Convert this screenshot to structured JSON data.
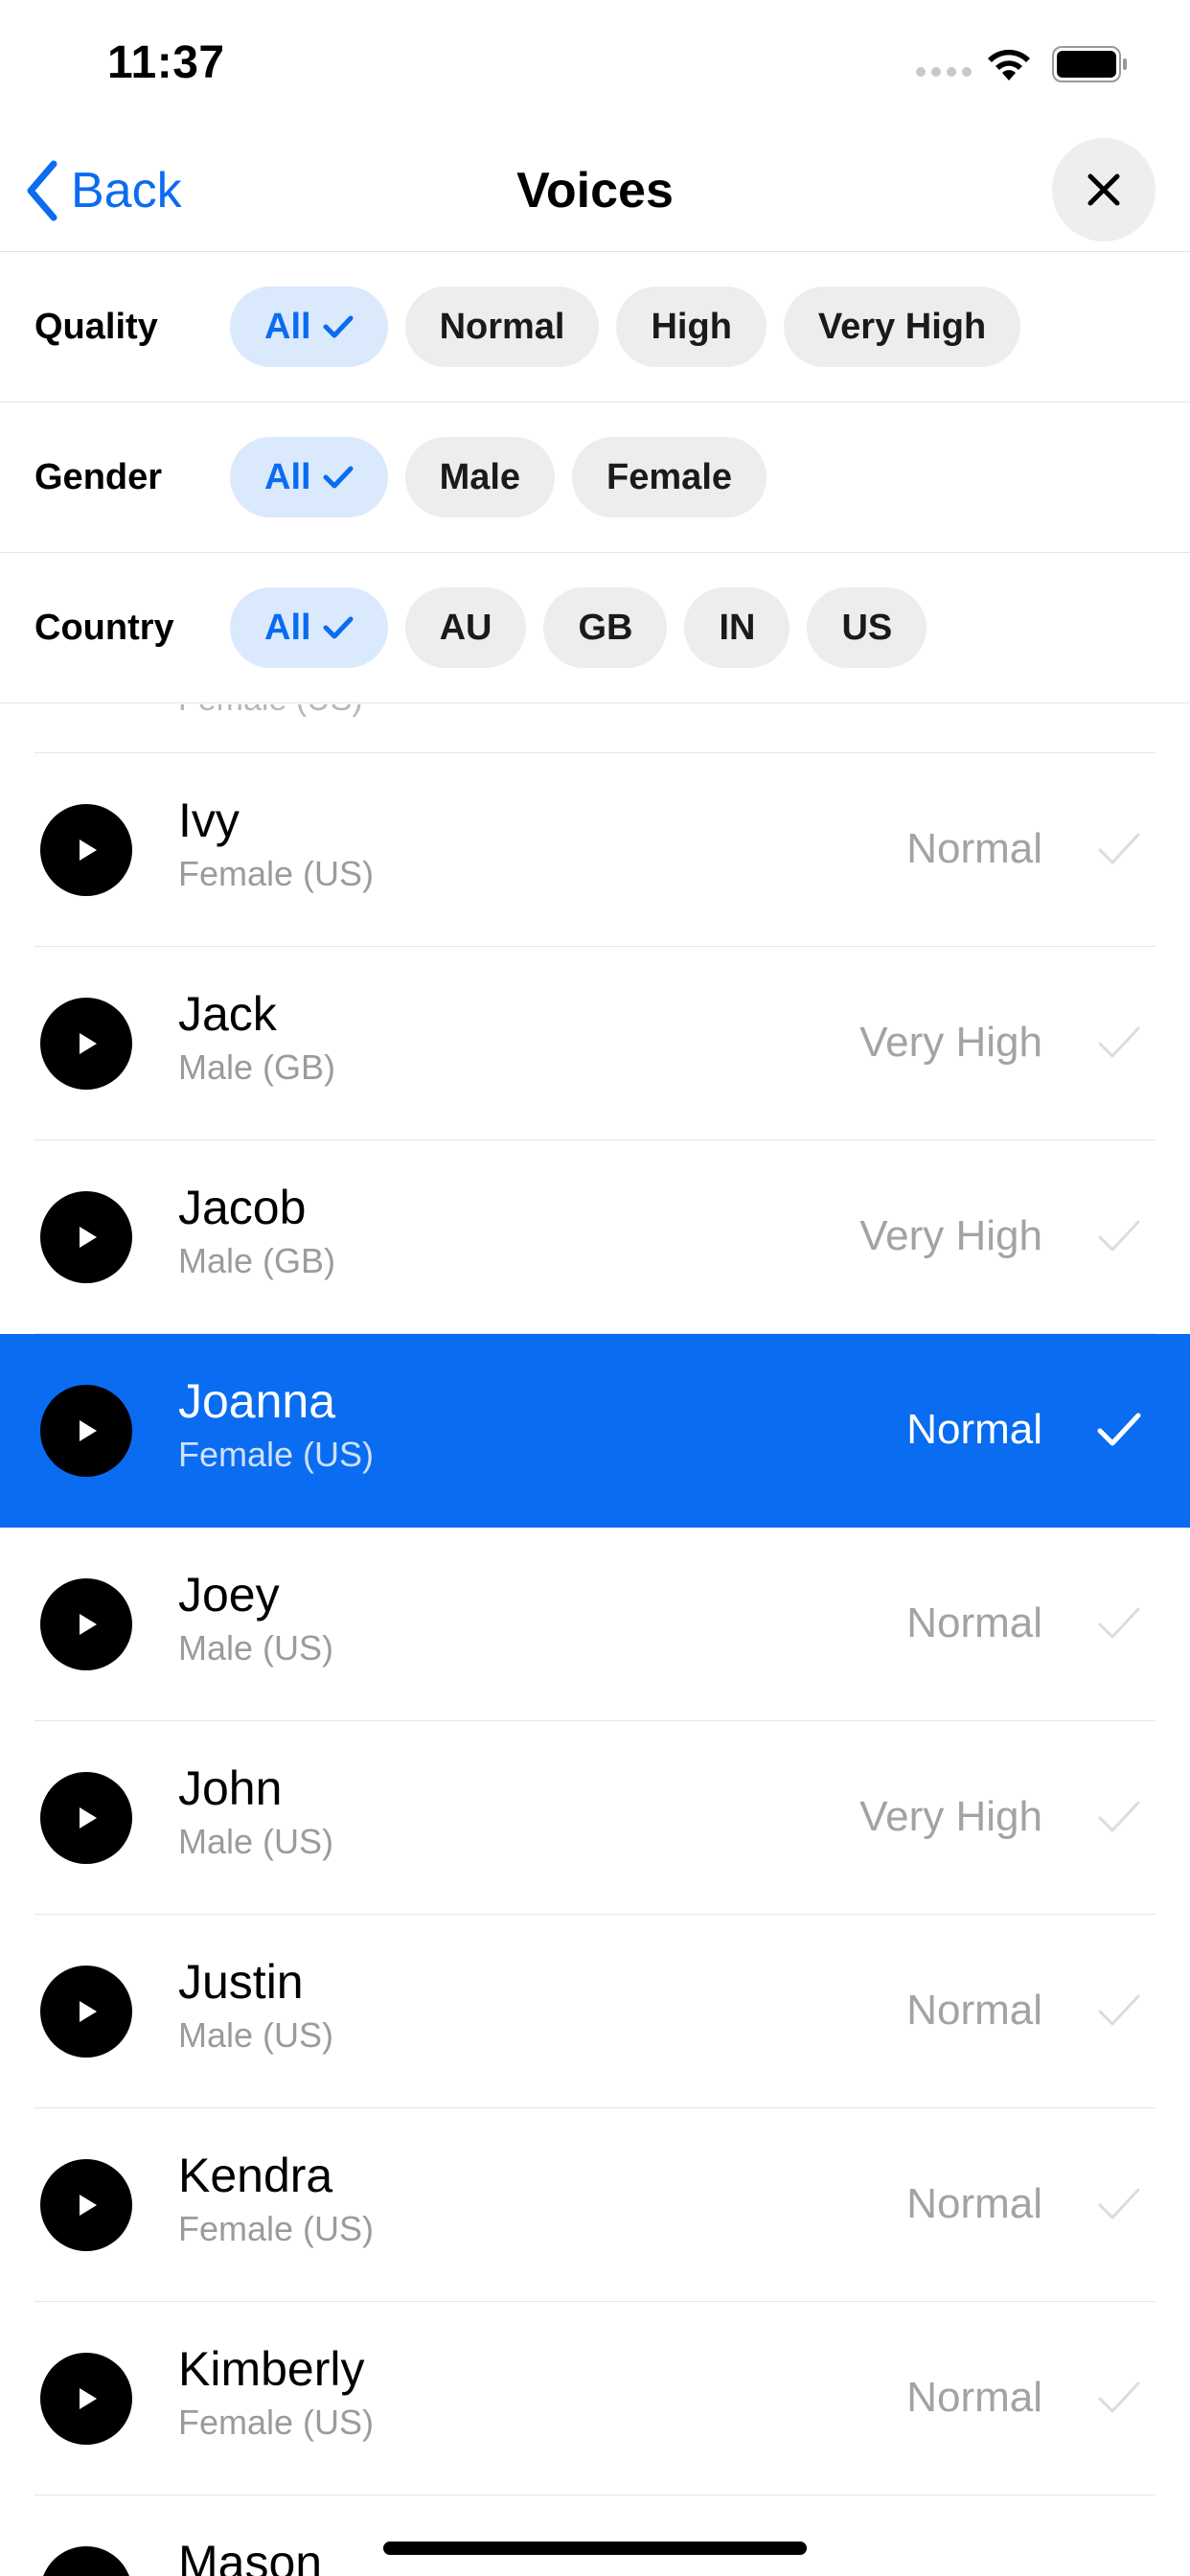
{
  "status_bar": {
    "time": "11:37"
  },
  "nav": {
    "back_label": "Back",
    "title": "Voices"
  },
  "filters": {
    "quality": {
      "label": "Quality",
      "options": [
        "All",
        "Normal",
        "High",
        "Very High"
      ],
      "selected": "All"
    },
    "gender": {
      "label": "Gender",
      "options": [
        "All",
        "Male",
        "Female"
      ],
      "selected": "All"
    },
    "country": {
      "label": "Country",
      "options": [
        "All",
        "AU",
        "GB",
        "IN",
        "US"
      ],
      "selected": "All"
    }
  },
  "list": {
    "partial_top_text": "Female (US)",
    "voices": [
      {
        "name": "Ivy",
        "detail": "Female (US)",
        "quality": "Normal",
        "selected": false
      },
      {
        "name": "Jack",
        "detail": "Male (GB)",
        "quality": "Very High",
        "selected": false
      },
      {
        "name": "Jacob",
        "detail": "Male (GB)",
        "quality": "Very High",
        "selected": false
      },
      {
        "name": "Joanna",
        "detail": "Female (US)",
        "quality": "Normal",
        "selected": true
      },
      {
        "name": "Joey",
        "detail": "Male (US)",
        "quality": "Normal",
        "selected": false
      },
      {
        "name": "John",
        "detail": "Male (US)",
        "quality": "Very High",
        "selected": false
      },
      {
        "name": "Justin",
        "detail": "Male (US)",
        "quality": "Normal",
        "selected": false
      },
      {
        "name": "Kendra",
        "detail": "Female (US)",
        "quality": "Normal",
        "selected": false
      },
      {
        "name": "Kimberly",
        "detail": "Female (US)",
        "quality": "Normal",
        "selected": false
      },
      {
        "name": "Mason",
        "detail": "",
        "quality": "",
        "selected": false
      }
    ]
  },
  "colors": {
    "accent": "#0a6cf0",
    "chip_bg": "#ededee",
    "chip_active_bg": "#dbe9fd",
    "secondary_text": "#9b9b9b"
  },
  "icons": {
    "back": "chevron-left-icon",
    "close": "close-icon",
    "play": "play-icon",
    "check": "checkmark-icon"
  }
}
